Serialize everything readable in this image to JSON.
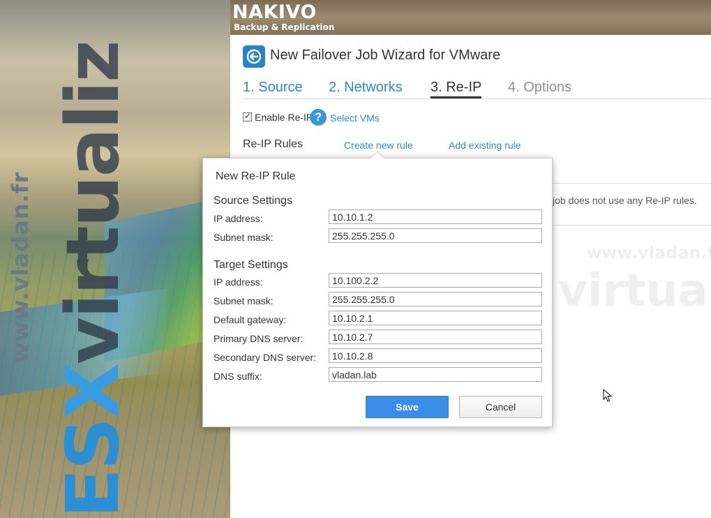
{
  "banner": {
    "url_text": "www.vladan.fr",
    "word_prefix": "ES",
    "word_x": "X",
    "word_suffix": "virtualiz"
  },
  "header": {
    "logo_name": "NAKIVO",
    "logo_sub": "Backup & Replication"
  },
  "wizard": {
    "title": "New Failover Job Wizard for VMware",
    "steps": [
      {
        "label": "1. Source",
        "state": "done"
      },
      {
        "label": "2. Networks",
        "state": "done"
      },
      {
        "label": "3. Re-IP",
        "state": "active"
      },
      {
        "label": "4. Options",
        "state": "todo"
      }
    ],
    "enable_reip_label": "Enable Re-IP",
    "enable_reip_checked": true,
    "select_vms_label": "Select VMs",
    "rules_title": "Re-IP Rules",
    "create_new_rule": "Create new rule",
    "add_existing_rule": "Add existing rule",
    "rules_empty_text": "job does not use any Re-IP rules."
  },
  "dialog": {
    "title": "New Re-IP Rule",
    "source": {
      "title": "Source Settings",
      "ip_label": "IP address:",
      "ip_value": "10.10.1.2",
      "mask_label": "Subnet mask:",
      "mask_value": "255.255.255.0"
    },
    "target": {
      "title": "Target Settings",
      "ip_label": "IP address:",
      "ip_value": "10.100.2.2",
      "mask_label": "Subnet mask:",
      "mask_value": "255.255.255.0",
      "gateway_label": "Default gateway:",
      "gateway_value": "10.10.2.1",
      "dns1_label": "Primary DNS server:",
      "dns1_value": "10.10.2.7",
      "dns2_label": "Secondary DNS server:",
      "dns2_value": "10.10.2.8",
      "suffix_label": "DNS suffix:",
      "suffix_value": "vladan.lab"
    },
    "save_label": "Save",
    "cancel_label": "Cancel"
  },
  "colors": {
    "accent": "#2a8ad4",
    "save_button": "#3b8ee8",
    "help_icon": "#3a97dc"
  },
  "icons": {
    "wizard": "failover-wizard-icon",
    "help": "question-mark-icon",
    "cursor": "mouse-pointer-icon"
  }
}
